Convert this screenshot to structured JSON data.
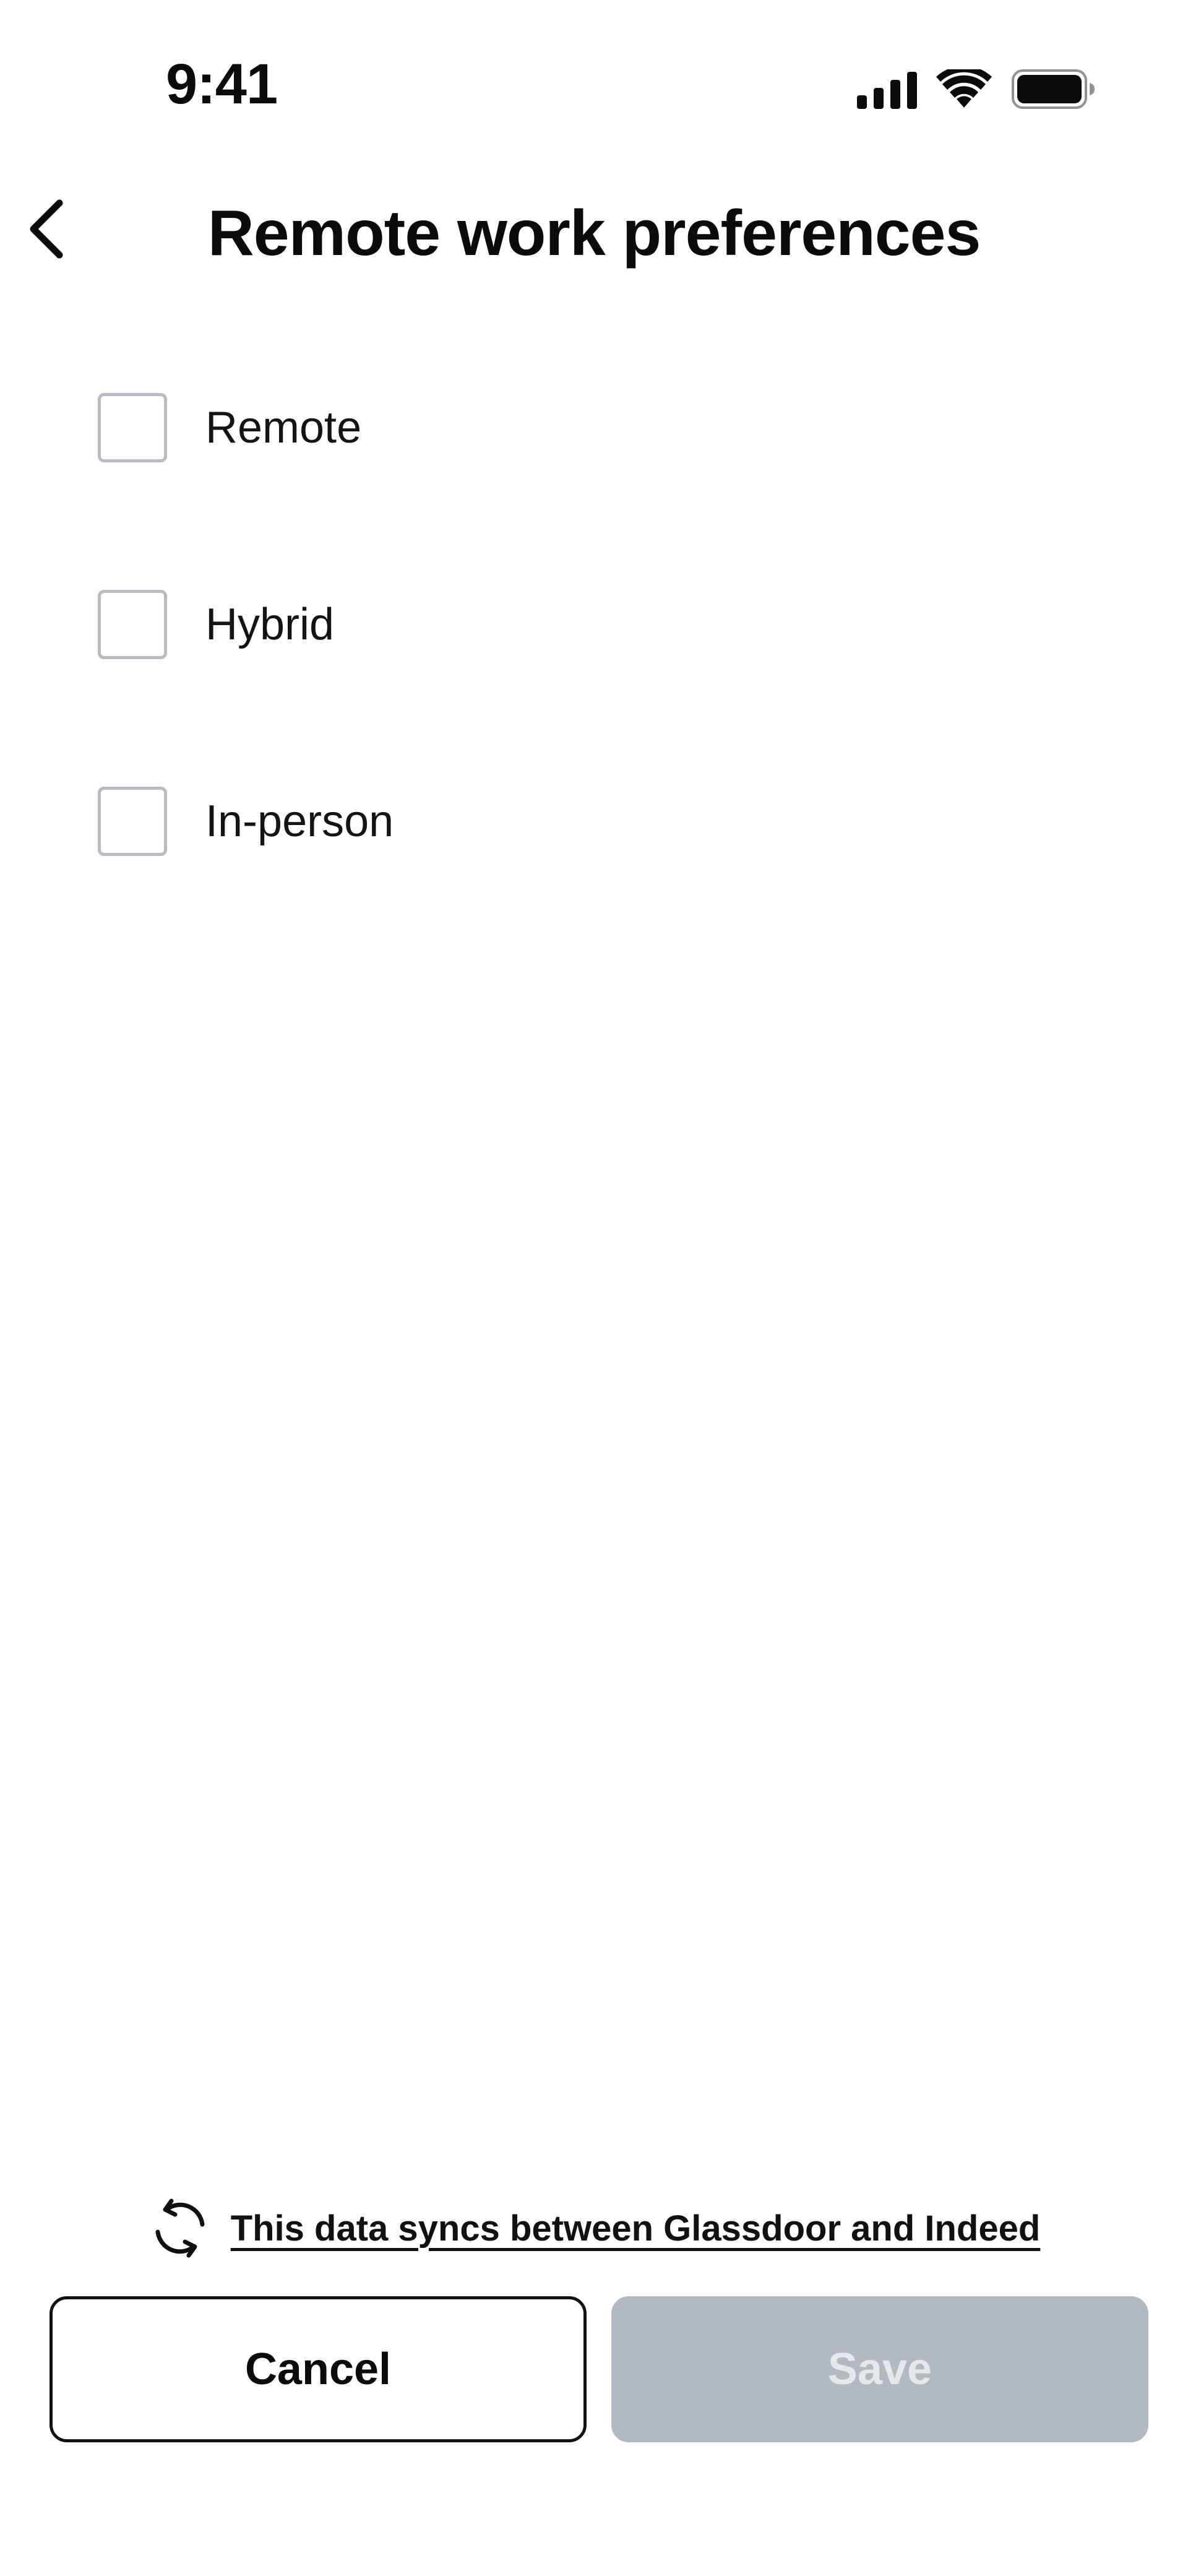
{
  "status_bar": {
    "time": "9:41",
    "icons": [
      "cellular-signal-icon",
      "wifi-icon",
      "battery-icon"
    ]
  },
  "header": {
    "back_icon": "chevron-left-icon",
    "title": "Remote work preferences"
  },
  "options": [
    {
      "label": "Remote",
      "checked": false
    },
    {
      "label": "Hybrid",
      "checked": false
    },
    {
      "label": "In-person",
      "checked": false
    }
  ],
  "sync_note": {
    "icon": "sync-icon",
    "text": "This data syncs between Glassdoor and Indeed"
  },
  "actions": {
    "cancel_label": "Cancel",
    "save_label": "Save",
    "save_enabled": false
  },
  "colors": {
    "text": "#0b0b0b",
    "checkbox_border": "#b7bcc2",
    "save_disabled_bg": "#b3b9c0",
    "save_disabled_text": "#e6e9ec"
  }
}
